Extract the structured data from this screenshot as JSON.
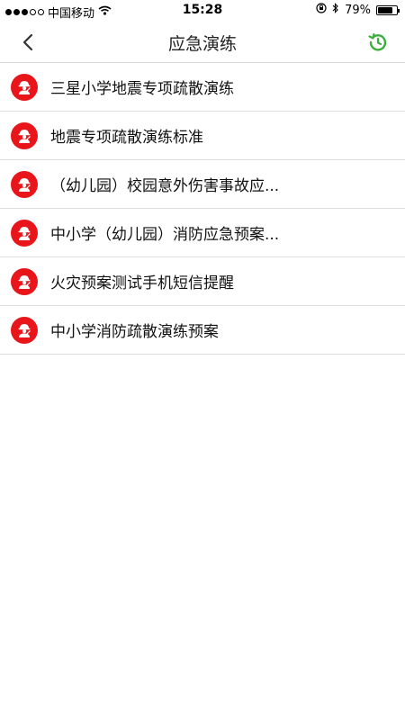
{
  "statusbar": {
    "carrier": "中国移动",
    "time": "15:28",
    "battery": "79%",
    "battery_level": 0.79,
    "signal_filled": 3,
    "signal_total": 5
  },
  "navbar": {
    "title": "应急演练"
  },
  "list": [
    {
      "label": "三星小学地震专项疏散演练"
    },
    {
      "label": "地震专项疏散演练标准"
    },
    {
      "label": "（幼儿园）校园意外伤害事故应..."
    },
    {
      "label": "中小学（幼儿园）消防应急预案..."
    },
    {
      "label": "火灾预案测试手机短信提醒"
    },
    {
      "label": "中小学消防疏散演练预案"
    }
  ],
  "colors": {
    "accent_red": "#e8161b",
    "history_green": "#3cae3c"
  }
}
